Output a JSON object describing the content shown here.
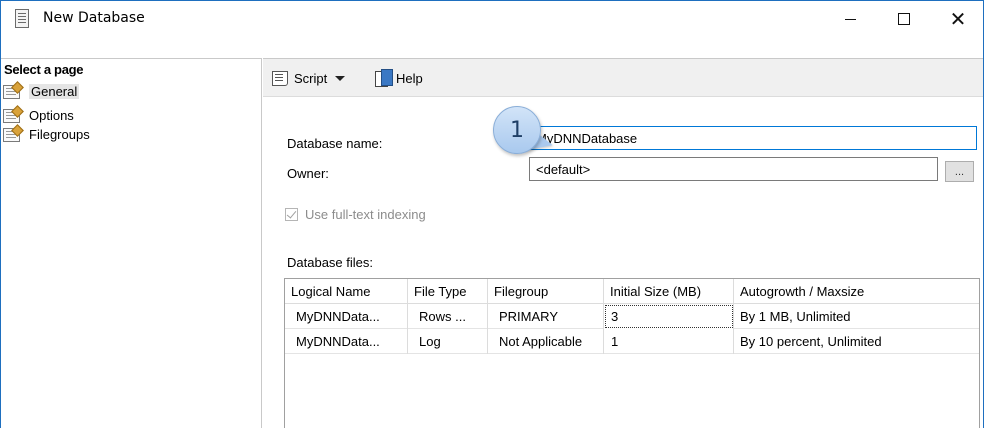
{
  "window": {
    "title": "New Database",
    "accent_color": "#1e6fbf"
  },
  "left_pane": {
    "header": "Select a page",
    "items": [
      {
        "label": "General",
        "icon": "page-settings-icon",
        "selected": true
      },
      {
        "label": "Options",
        "icon": "page-settings-icon",
        "selected": false
      },
      {
        "label": "Filegroups",
        "icon": "page-settings-icon",
        "selected": false
      }
    ]
  },
  "toolbar": {
    "script_label": "Script",
    "help_label": "Help"
  },
  "form": {
    "db_name_label": "Database name:",
    "db_name_value": "MyDNNDatabase",
    "owner_label": "Owner:",
    "owner_value": "<default>",
    "browse_label": "...",
    "fulltext_label": "Use full-text indexing",
    "fulltext_checked": true,
    "fulltext_enabled": false,
    "callout_number": "1"
  },
  "database_files": {
    "label": "Database files:",
    "columns": [
      "Logical Name",
      "File Type",
      "Filegroup",
      "Initial Size (MB)",
      "Autogrowth / Maxsize"
    ],
    "rows": [
      [
        "MyDNNData...",
        "Rows ...",
        "PRIMARY",
        "3",
        "By 1 MB, Unlimited"
      ],
      [
        "MyDNNData...",
        "Log",
        "Not Applicable",
        "1",
        "By 10 percent, Unlimited"
      ]
    ]
  }
}
